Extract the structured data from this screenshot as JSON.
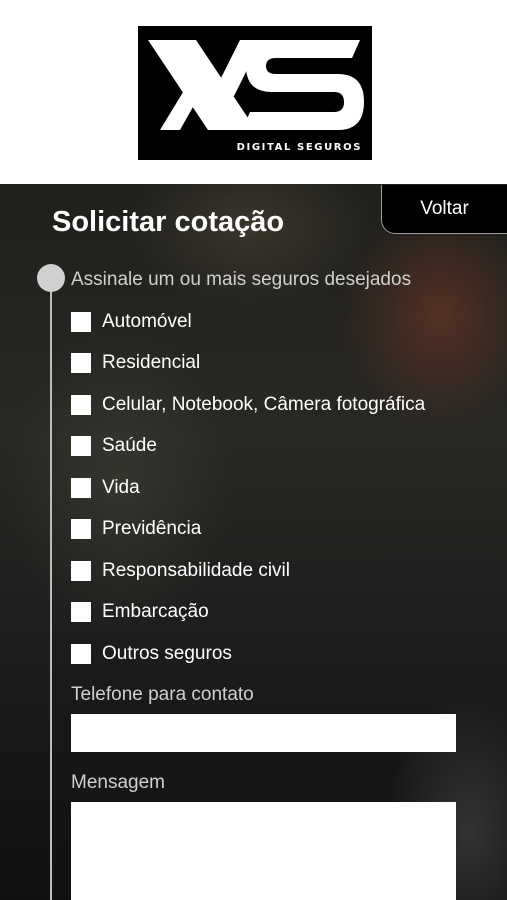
{
  "brand": {
    "logo_text": "XS",
    "logo_subtitle": "DIGITAL SEGUROS",
    "colors": {
      "background": "#000000",
      "foreground": "#ffffff"
    }
  },
  "form": {
    "title": "Solicitar cotação",
    "back_label": "Voltar",
    "instruction": "Assinale um ou mais seguros desejados",
    "options": [
      {
        "label": "Automóvel",
        "checked": false
      },
      {
        "label": "Residencial",
        "checked": false
      },
      {
        "label": "Celular, Notebook, Câmera fotográfica",
        "checked": false
      },
      {
        "label": "Saúde",
        "checked": false
      },
      {
        "label": "Vida",
        "checked": false
      },
      {
        "label": "Previdência",
        "checked": false
      },
      {
        "label": "Responsabilidade civil",
        "checked": false
      },
      {
        "label": "Embarcação",
        "checked": false
      },
      {
        "label": "Outros seguros",
        "checked": false
      }
    ],
    "phone": {
      "label": "Telefone para contato",
      "value": "",
      "placeholder": ""
    },
    "message": {
      "label": "Mensagem",
      "value": "",
      "placeholder": ""
    }
  }
}
